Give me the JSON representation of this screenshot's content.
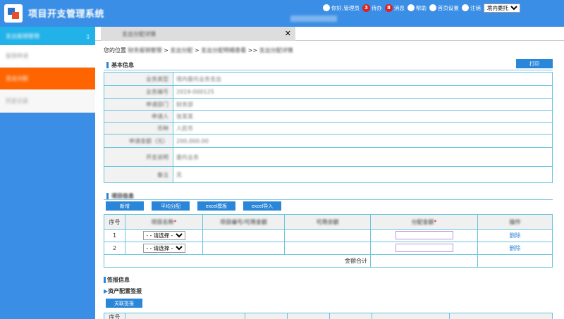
{
  "header": {
    "app_title": "项目开支管理系统",
    "greeting": "你好,管理员",
    "todo_count": "3",
    "todo_label": "待办",
    "msg_count": "8",
    "msg_label": "消息",
    "help_label": "帮助",
    "home_settings_label": "首页设置",
    "logout_label": "注销",
    "scope_select_value": "境内委托"
  },
  "sidebar": {
    "title": "支出报销管理",
    "items": [
      "报销申请",
      "支出分配",
      "历史记录"
    ]
  },
  "tabs": [
    {
      "label": "支出分配详情"
    }
  ],
  "breadcrumb": {
    "prefix": "您的位置",
    "p1": "财务报销管理",
    "p2": "支出分配",
    "p3": "支出分配明细查看",
    "p4": "支出分配详情"
  },
  "basic_info": {
    "title": "基本信息",
    "print_label": "打印",
    "rows": [
      {
        "k": "业务类型",
        "v": "境内委托业务支出"
      },
      {
        "k": "业务编号",
        "v": "2019-000125"
      },
      {
        "k": "申请部门",
        "v": "财务部"
      },
      {
        "k": "申请人",
        "v": "张某某"
      },
      {
        "k": "币种",
        "v": "人民币"
      },
      {
        "k": "申请金额（元）",
        "v": "200,000.00"
      },
      {
        "k": "开支说明",
        "v": "委托业务"
      },
      {
        "k": "备注",
        "v": "无"
      }
    ]
  },
  "allocation": {
    "title": "项目信息",
    "buttons": {
      "add": "新增",
      "avg": "平均分配",
      "excel_tpl": "excel模板",
      "excel_import": "excel导入"
    },
    "columns": [
      "序号",
      "项目名称",
      "项目编号/可用金额",
      "可用余额",
      "分配金额",
      "操作"
    ],
    "rows": [
      {
        "no": "1",
        "select": "- - 请选择 - -",
        "op": "删除"
      },
      {
        "no": "2",
        "select": "- - 请选择 - -",
        "op": "删除"
      }
    ],
    "total_label": "金额合计"
  },
  "report": {
    "title": "签报信息",
    "subtitle": "资产配置签报",
    "link_button": "关联签报",
    "columns": [
      "序号"
    ]
  }
}
